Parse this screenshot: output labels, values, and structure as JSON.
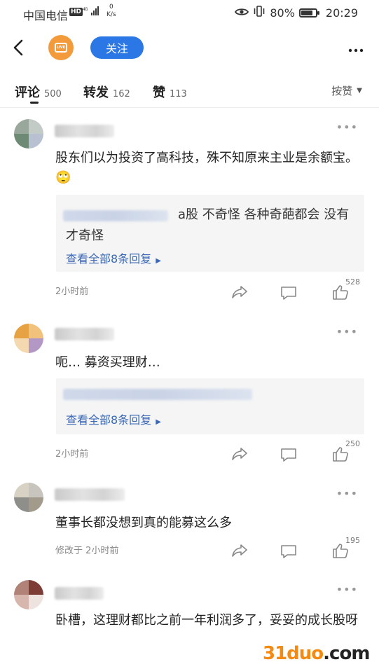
{
  "status_bar": {
    "carrier": "中国电信",
    "hd": "HD",
    "speed_value": "0",
    "speed_unit": "K/s",
    "battery": "80%",
    "battery_level": 0.8,
    "time": "20:29"
  },
  "header": {
    "live_badge": "LIVE",
    "follow_label": "关注"
  },
  "tabs": [
    {
      "label": "评论",
      "count": "500"
    },
    {
      "label": "转发",
      "count": "162"
    },
    {
      "label": "赞",
      "count": "113"
    }
  ],
  "sort_label": "按赞",
  "comments": [
    {
      "text": "股东们以为投资了高科技，殊不知原来主业是余额宝。🙄",
      "reply_text": "a股 不奇怪 各种奇葩都会 没有才奇怪",
      "reply_link": "查看全部8条回复",
      "time": "2小时前",
      "likes": "528"
    },
    {
      "text": "呃… 募资买理财…",
      "reply_link": "查看全部8条回复",
      "time": "2小时前",
      "likes": "250"
    },
    {
      "text": "董事长都没想到真的能募这么多",
      "time": "修改于 2小时前",
      "likes": "195"
    },
    {
      "text": "卧槽，这理财都比之前一年利润多了，妥妥的成长股呀"
    }
  ],
  "watermark": {
    "brand": "31duo",
    "suffix": ".com"
  },
  "icons": {
    "back": "chevron-left-icon",
    "more": "more-horizontal-icon",
    "share": "share-icon",
    "comment": "comment-icon",
    "like": "thumbs-up-icon",
    "eye": "eye-icon",
    "vibrate": "vibrate-icon",
    "battery": "battery-icon",
    "signal": "signal-icon"
  },
  "colors": {
    "follow_button": "#2b77e6",
    "reply_link": "#3c68b5",
    "live_avatar": "#f39a3a",
    "watermark": "#f38a12"
  }
}
